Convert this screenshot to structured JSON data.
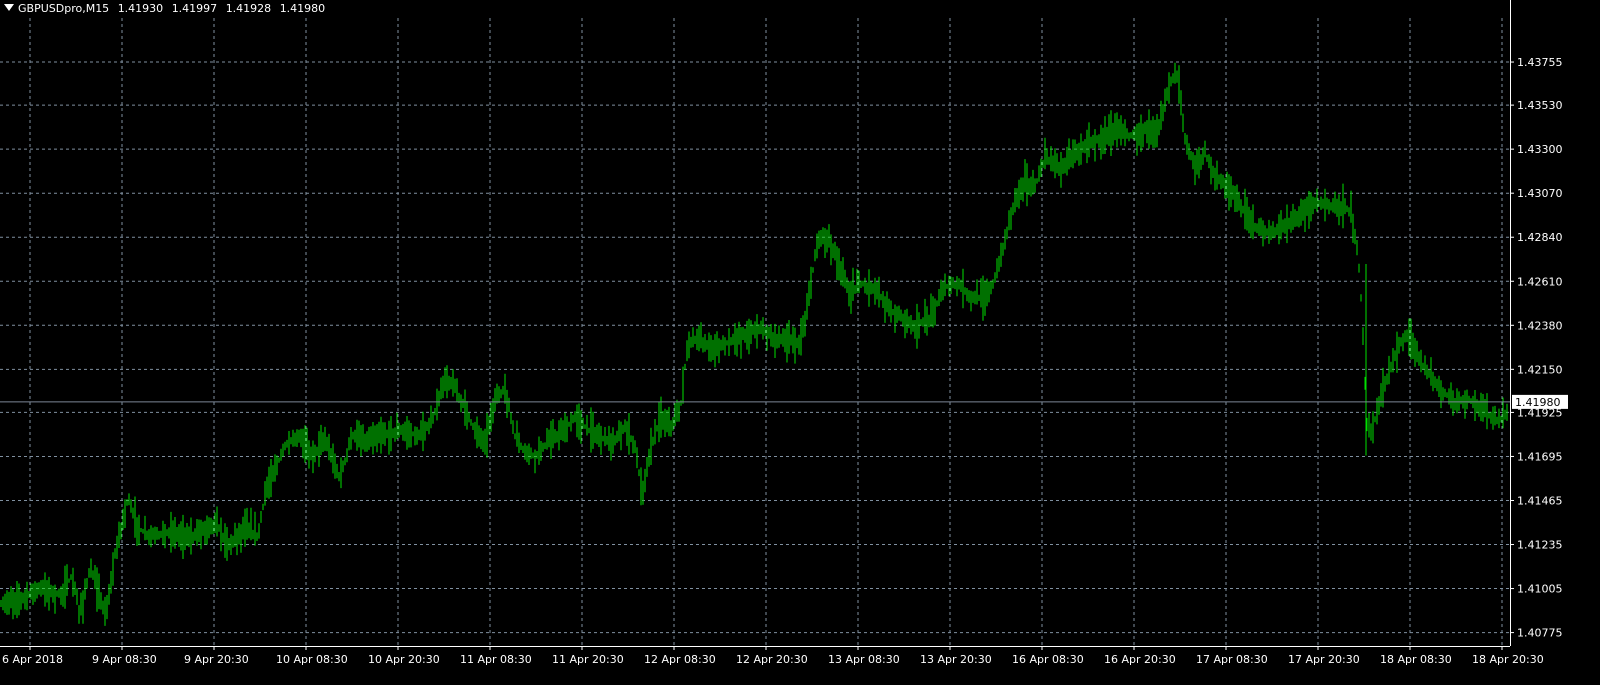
{
  "header": {
    "symbol": "GBPUSDpro,M15",
    "open": "1.41930",
    "high": "1.41997",
    "low": "1.41928",
    "close": "1.41980"
  },
  "colors": {
    "background": "#000000",
    "grid": "#8090a0",
    "bars": "#00e000",
    "axis_text": "#ffffff",
    "price_line": "#7d8796"
  },
  "chart_data": {
    "type": "line",
    "style": "ohlc-bars",
    "grid": true,
    "y_ticks": [
      "1.43755",
      "1.43530",
      "1.43300",
      "1.43070",
      "1.42840",
      "1.42610",
      "1.42380",
      "1.42150",
      "1.41925",
      "1.41695",
      "1.41465",
      "1.41235",
      "1.41005",
      "1.40775"
    ],
    "x_ticks": [
      "6 Apr 2018",
      "9 Apr 08:30",
      "9 Apr 20:30",
      "10 Apr 08:30",
      "10 Apr 20:30",
      "11 Apr 08:30",
      "11 Apr 20:30",
      "12 Apr 08:30",
      "12 Apr 20:30",
      "13 Apr 08:30",
      "13 Apr 20:30",
      "16 Apr 08:30",
      "16 Apr 20:30",
      "17 Apr 08:30",
      "17 Apr 20:30",
      "18 Apr 08:30",
      "18 Apr 20:30"
    ],
    "ylim": [
      1.40705,
      1.43985
    ],
    "current_price": "1.41980",
    "series": [
      {
        "values": [
          [
            0,
            1.4092
          ],
          [
            20,
            1.4095
          ],
          [
            40,
            1.4101
          ],
          [
            60,
            1.4097
          ],
          [
            72,
            1.4107
          ],
          [
            80,
            1.4087
          ],
          [
            90,
            1.4111
          ],
          [
            100,
            1.4096
          ],
          [
            106,
            1.4086
          ],
          [
            115,
            1.4118
          ],
          [
            128,
            1.4148
          ],
          [
            138,
            1.4132
          ],
          [
            150,
            1.4128
          ],
          [
            170,
            1.413
          ],
          [
            190,
            1.4127
          ],
          [
            215,
            1.4135
          ],
          [
            228,
            1.4123
          ],
          [
            245,
            1.4132
          ],
          [
            258,
            1.4128
          ],
          [
            265,
            1.415
          ],
          [
            272,
            1.4159
          ],
          [
            285,
            1.4175
          ],
          [
            300,
            1.418
          ],
          [
            312,
            1.417
          ],
          [
            325,
            1.4178
          ],
          [
            340,
            1.4158
          ],
          [
            352,
            1.4181
          ],
          [
            365,
            1.4177
          ],
          [
            380,
            1.418
          ],
          [
            400,
            1.4183
          ],
          [
            420,
            1.418
          ],
          [
            432,
            1.4188
          ],
          [
            445,
            1.421
          ],
          [
            455,
            1.4205
          ],
          [
            465,
            1.4195
          ],
          [
            475,
            1.4183
          ],
          [
            485,
            1.4177
          ],
          [
            495,
            1.4199
          ],
          [
            505,
            1.4205
          ],
          [
            515,
            1.418
          ],
          [
            525,
            1.4172
          ],
          [
            535,
            1.417
          ],
          [
            550,
            1.4178
          ],
          [
            565,
            1.4183
          ],
          [
            575,
            1.419
          ],
          [
            585,
            1.4185
          ],
          [
            600,
            1.418
          ],
          [
            615,
            1.4177
          ],
          [
            625,
            1.4185
          ],
          [
            635,
            1.4175
          ],
          [
            642,
            1.415
          ],
          [
            650,
            1.4172
          ],
          [
            660,
            1.419
          ],
          [
            670,
            1.4185
          ],
          [
            680,
            1.4193
          ],
          [
            688,
            1.423
          ],
          [
            700,
            1.423
          ],
          [
            715,
            1.4225
          ],
          [
            730,
            1.423
          ],
          [
            745,
            1.4233
          ],
          [
            760,
            1.4237
          ],
          [
            775,
            1.4231
          ],
          [
            790,
            1.423
          ],
          [
            800,
            1.4228
          ],
          [
            808,
            1.4248
          ],
          [
            815,
            1.4275
          ],
          [
            822,
            1.4285
          ],
          [
            830,
            1.4282
          ],
          [
            840,
            1.4268
          ],
          [
            850,
            1.4255
          ],
          [
            862,
            1.426
          ],
          [
            875,
            1.4257
          ],
          [
            888,
            1.4247
          ],
          [
            900,
            1.4243
          ],
          [
            915,
            1.4237
          ],
          [
            930,
            1.4242
          ],
          [
            945,
            1.4258
          ],
          [
            958,
            1.426
          ],
          [
            970,
            1.4253
          ],
          [
            985,
            1.4252
          ],
          [
            995,
            1.4262
          ],
          [
            1005,
            1.4282
          ],
          [
            1015,
            1.4305
          ],
          [
            1025,
            1.4313
          ],
          [
            1035,
            1.431
          ],
          [
            1045,
            1.4326
          ],
          [
            1060,
            1.432
          ],
          [
            1075,
            1.4328
          ],
          [
            1090,
            1.4333
          ],
          [
            1105,
            1.4336
          ],
          [
            1120,
            1.4342
          ],
          [
            1130,
            1.4337
          ],
          [
            1145,
            1.434
          ],
          [
            1160,
            1.4342
          ],
          [
            1170,
            1.4365
          ],
          [
            1178,
            1.4369
          ],
          [
            1185,
            1.4335
          ],
          [
            1195,
            1.432
          ],
          [
            1205,
            1.4328
          ],
          [
            1215,
            1.4316
          ],
          [
            1228,
            1.431
          ],
          [
            1240,
            1.43
          ],
          [
            1255,
            1.429
          ],
          [
            1270,
            1.4285
          ],
          [
            1285,
            1.429
          ],
          [
            1300,
            1.4296
          ],
          [
            1315,
            1.4302
          ],
          [
            1330,
            1.4301
          ],
          [
            1345,
            1.43
          ],
          [
            1352,
            1.4295
          ],
          [
            1358,
            1.4275
          ],
          [
            1362,
            1.4245
          ],
          [
            1367,
            1.4185
          ],
          [
            1372,
            1.4183
          ],
          [
            1380,
            1.42
          ],
          [
            1390,
            1.4215
          ],
          [
            1400,
            1.4228
          ],
          [
            1410,
            1.4235
          ],
          [
            1418,
            1.4221
          ],
          [
            1428,
            1.4213
          ],
          [
            1440,
            1.4205
          ],
          [
            1455,
            1.4198
          ],
          [
            1468,
            1.42
          ],
          [
            1480,
            1.4195
          ],
          [
            1492,
            1.419
          ],
          [
            1500,
            1.4188
          ],
          [
            1508,
            1.4193
          ]
        ]
      }
    ]
  }
}
